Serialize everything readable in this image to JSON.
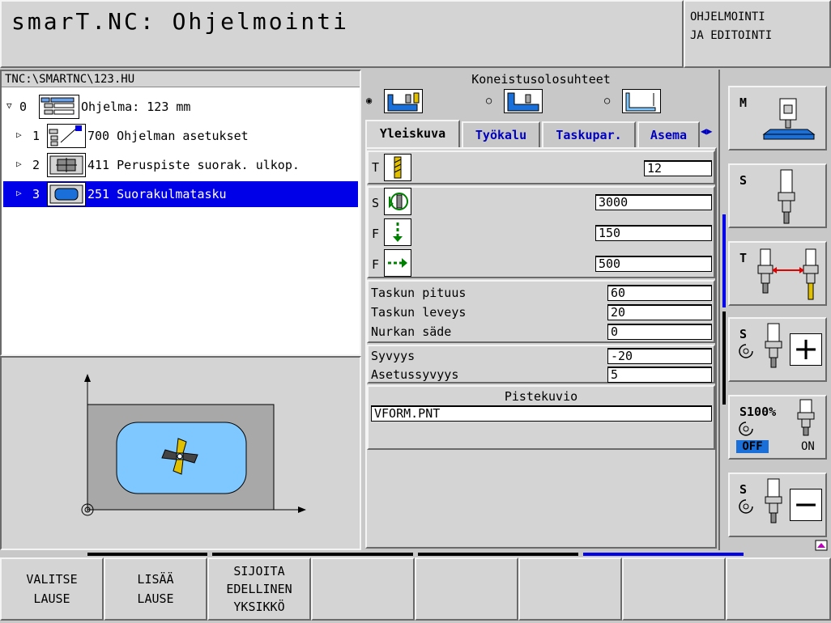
{
  "header": {
    "title": "smarT.NC: Ohjelmointi",
    "mode": "OHJELMOINTI\nJA EDITOINTI"
  },
  "tree": {
    "path": "TNC:\\SMARTNC\\123.HU",
    "rows": [
      {
        "num": "0",
        "text": "Ohjelma: 123 mm",
        "tri": "▽"
      },
      {
        "num": "1",
        "text": "700 Ohjelman asetukset",
        "tri": "▷"
      },
      {
        "num": "2",
        "text": "411 Peruspiste suorak. ulkop.",
        "tri": "▷"
      },
      {
        "num": "3",
        "text": "251 Suorakulmatasku",
        "tri": "▷"
      }
    ]
  },
  "form": {
    "section_title": "Koneistusolosuhteet",
    "tabs": [
      "Yleiskuva",
      "Työkalu",
      "Taskupar.",
      "Asema"
    ],
    "tool": {
      "label": "T",
      "value": "12"
    },
    "spindle": {
      "label": "S",
      "value": "3000"
    },
    "feed_plunge": {
      "label": "F",
      "value": "150"
    },
    "feed_mill": {
      "label": "F",
      "value": "500"
    },
    "pocket": [
      {
        "label": "Taskun pituus",
        "value": "60"
      },
      {
        "label": "Taskun leveys",
        "value": "20"
      },
      {
        "label": "Nurkan säde",
        "value": "0"
      }
    ],
    "depth": [
      {
        "label": "Syvyys",
        "value": "-20"
      },
      {
        "label": "Asetussyvyys",
        "value": "5"
      }
    ],
    "pattern": {
      "title": "Pistekuvio",
      "value": "VFORM.PNT"
    }
  },
  "side": {
    "m": "M",
    "s1": "S",
    "t": "T",
    "s_plus": "S",
    "s100": "S100%",
    "off": "OFF",
    "on": "ON",
    "s_minus": "S"
  },
  "softkeys": [
    "VALITSE\nLAUSE",
    "LISÄÄ\nLAUSE",
    "SIJOITA\nEDELLINEN\nYKSIKKÖ",
    "",
    "",
    "",
    "",
    ""
  ],
  "colors": {
    "selection": "#0000e8",
    "tab_text": "#0000c0",
    "pocket_fill": "#7ec8ff",
    "plate": "#a8a8a8",
    "off_bg": "#1a6fd8"
  }
}
